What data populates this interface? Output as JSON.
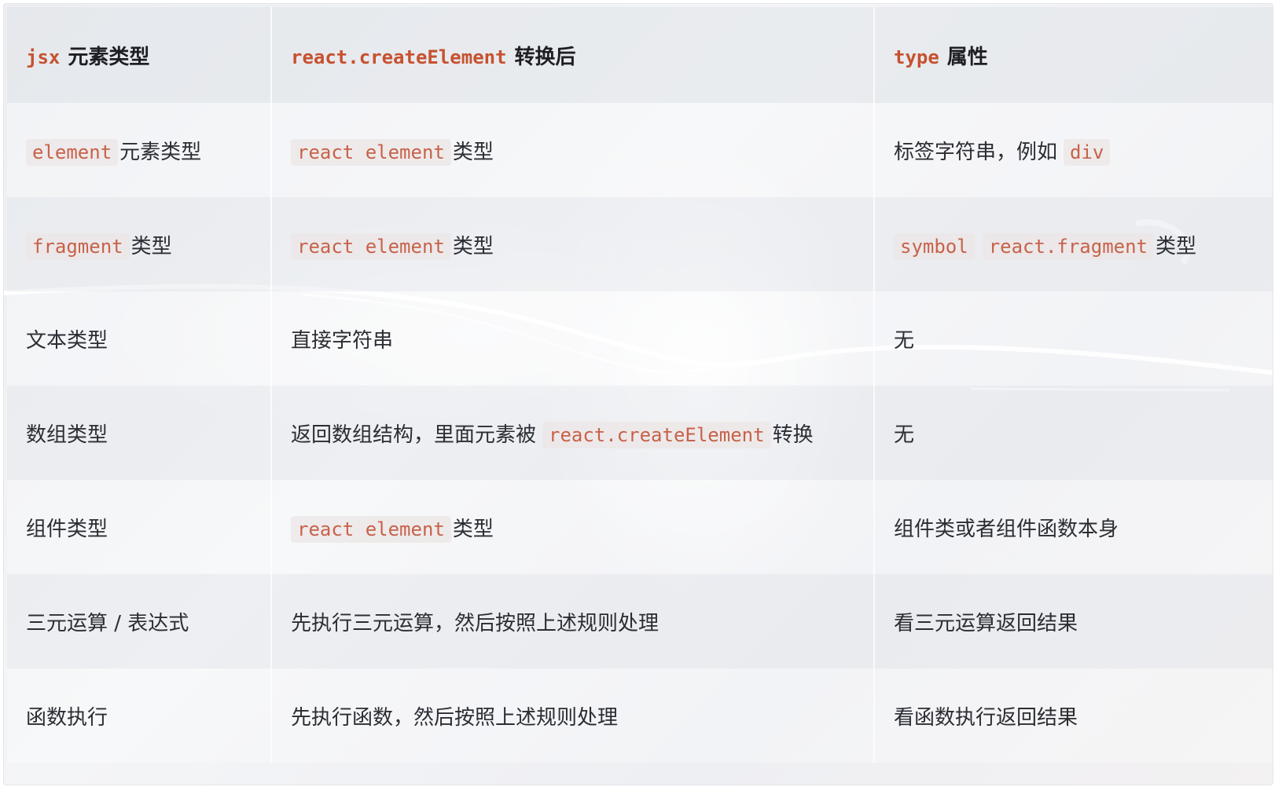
{
  "header": {
    "col1_code": "jsx",
    "col1_text": "元素类型",
    "col2_code": "react.createElement",
    "col2_text": "转换后",
    "col3_code": "type",
    "col3_text": "属性"
  },
  "rows": [
    {
      "c1_code": "element",
      "c1_text": "元素类型",
      "c2_code": "react element",
      "c2_text": "类型",
      "c3_text": "标签字符串，例如",
      "c3_code": "div"
    },
    {
      "c1_code": "fragment",
      "c1_text": "类型",
      "c2_code": "react element",
      "c2_text": "类型",
      "c3_code": "symbol",
      "c3_code2": "react.fragment",
      "c3_text": "类型"
    },
    {
      "c1_text": "文本类型",
      "c2_text": "直接字符串",
      "c3_text": "无"
    },
    {
      "c1_text": "数组类型",
      "c2_text": "返回数组结构，里面元素被",
      "c2_code": "react.createElement",
      "c2_text_after": "转换",
      "c3_text": "无"
    },
    {
      "c1_text": "组件类型",
      "c2_code": "react element",
      "c2_text": "类型",
      "c3_text": "组件类或者组件函数本身"
    },
    {
      "c1_text": "三元运算 / 表达式",
      "c2_text": "先执行三元运算，然后按照上述规则处理",
      "c3_text": "看三元运算返回结果"
    },
    {
      "c1_text": "函数执行",
      "c2_text": "先执行函数，然后按照上述规则处理",
      "c3_text": "看函数执行返回结果"
    }
  ]
}
